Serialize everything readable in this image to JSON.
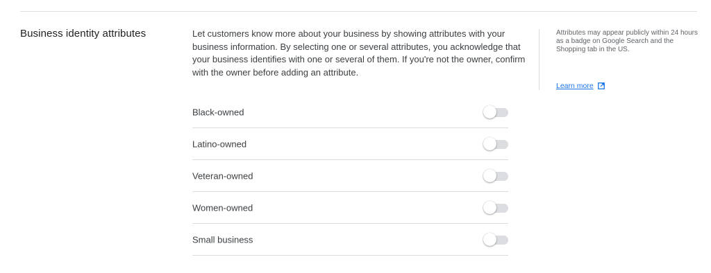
{
  "section": {
    "title": "Business identity attributes",
    "description": "Let customers know more about your business by showing attributes with your business information. By selecting one or several attributes, you acknowledge that your business identifies with one or several of them. If you're not the owner, confirm with the owner before adding an attribute."
  },
  "side_panel": {
    "note": "Attributes may appear publicly within 24 hours as a badge on Google Search and the Shopping tab in the US.",
    "link_label": "Learn more",
    "link_icon": "open-in-new-icon",
    "link_color": "#1a73e8"
  },
  "attributes": [
    {
      "label": "Black-owned",
      "enabled": false
    },
    {
      "label": "Latino-owned",
      "enabled": false
    },
    {
      "label": "Veteran-owned",
      "enabled": false
    },
    {
      "label": "Women-owned",
      "enabled": false
    },
    {
      "label": "Small business",
      "enabled": false
    }
  ]
}
